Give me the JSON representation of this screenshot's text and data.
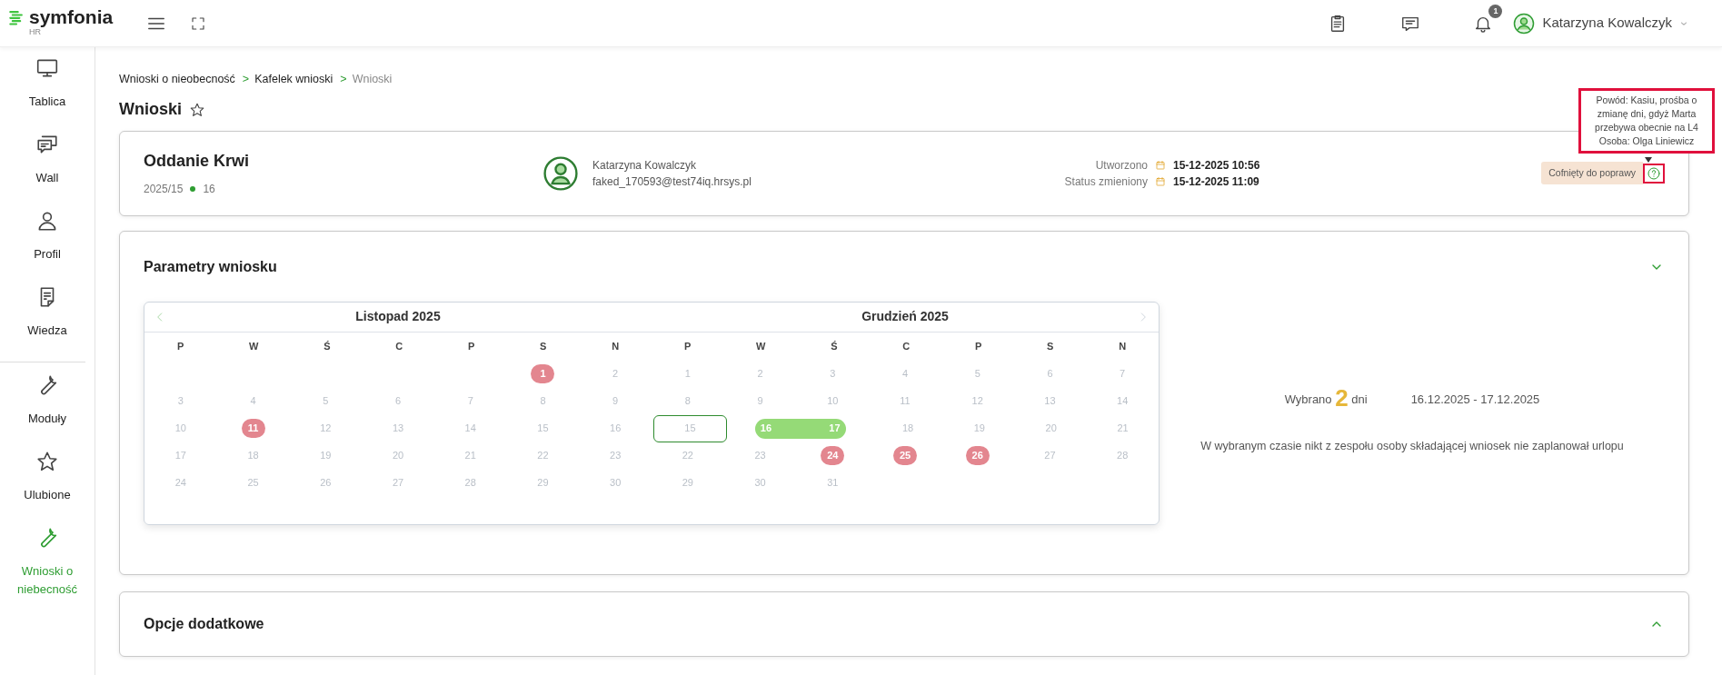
{
  "header": {
    "logo": {
      "name": "symfonia",
      "sub": "HR"
    },
    "notifications": {
      "count": "1"
    },
    "user": {
      "name": "Katarzyna Kowalczyk"
    }
  },
  "sidebar": {
    "groups": [
      {
        "items": [
          {
            "label": "Tablica",
            "selected": false
          },
          {
            "label": "Wall",
            "selected": false
          },
          {
            "label": "Profil",
            "selected": false
          },
          {
            "label": "Wiedza",
            "selected": false
          }
        ]
      },
      {
        "items": [
          {
            "label": "Moduły",
            "selected": false
          },
          {
            "label": "Ulubione",
            "selected": false
          },
          {
            "label": "Wnioski o niebecność",
            "selected": true
          }
        ]
      }
    ]
  },
  "breadcrumb": [
    {
      "label": "Wnioski o nieobecność",
      "current": false
    },
    {
      "separator": ">",
      "label": "Kafelek wnioski",
      "current": false
    },
    {
      "separator": ">",
      "label": "Wnioski",
      "current": true
    }
  ],
  "page": {
    "title": "Wnioski",
    "favorite": false
  },
  "request": {
    "title": "Oddanie Krwi",
    "number": "2025/15",
    "count": "16",
    "person": {
      "name": "Katarzyna Kowalczyk",
      "email": "faked_170593@test74iq.hrsys.pl"
    },
    "dates": [
      {
        "label": "Utworzono",
        "value": "15-12-2025 10:56"
      },
      {
        "label": "Status zmieniony",
        "value": "15-12-2025 11:09"
      }
    ],
    "status": {
      "label": "Cofnięty do poprawy",
      "tooltip": [
        "Powód: Kasiu, prośba o",
        "zmianę dni, gdyż Marta",
        "przebywa obecnie na L4",
        "Osoba: Olga Liniewicz"
      ]
    }
  },
  "sections": [
    {
      "title": "Parametry wniosku",
      "expanded": true
    },
    {
      "title": "Opcje dodatkowe",
      "expanded": false
    }
  ],
  "calendar": {
    "months": [
      {
        "title": "Listopad 2025",
        "weekdays": [
          "P",
          "W",
          "Ś",
          "C",
          "P",
          "S",
          "N"
        ],
        "weeks": [
          {
            "days": [
              {
                "kind": "blank"
              },
              {
                "kind": "blank"
              },
              {
                "kind": "blank"
              },
              {
                "kind": "blank"
              },
              {
                "kind": "blank"
              },
              {
                "day": "1",
                "kind": "holiday"
              },
              {
                "day": "2",
                "kind": "normal"
              }
            ]
          },
          {
            "days": [
              {
                "day": "3",
                "kind": "normal"
              },
              {
                "day": "4",
                "kind": "normal"
              },
              {
                "day": "5",
                "kind": "normal"
              },
              {
                "day": "6",
                "kind": "normal"
              },
              {
                "day": "7",
                "kind": "normal"
              },
              {
                "day": "8",
                "kind": "normal"
              },
              {
                "day": "9",
                "kind": "normal"
              }
            ]
          },
          {
            "days": [
              {
                "day": "10",
                "kind": "normal"
              },
              {
                "day": "11",
                "kind": "holiday"
              },
              {
                "day": "12",
                "kind": "normal"
              },
              {
                "day": "13",
                "kind": "normal"
              },
              {
                "day": "14",
                "kind": "normal"
              },
              {
                "day": "15",
                "kind": "normal"
              },
              {
                "day": "16",
                "kind": "normal"
              }
            ]
          },
          {
            "days": [
              {
                "day": "17",
                "kind": "normal"
              },
              {
                "day": "18",
                "kind": "normal"
              },
              {
                "day": "19",
                "kind": "normal"
              },
              {
                "day": "20",
                "kind": "normal"
              },
              {
                "day": "21",
                "kind": "normal"
              },
              {
                "day": "22",
                "kind": "normal"
              },
              {
                "day": "23",
                "kind": "normal"
              }
            ]
          },
          {
            "days": [
              {
                "day": "24",
                "kind": "normal"
              },
              {
                "day": "25",
                "kind": "normal"
              },
              {
                "day": "26",
                "kind": "normal"
              },
              {
                "day": "27",
                "kind": "normal"
              },
              {
                "day": "28",
                "kind": "normal"
              },
              {
                "day": "29",
                "kind": "normal"
              },
              {
                "day": "30",
                "kind": "normal"
              }
            ]
          }
        ]
      },
      {
        "title": "Grudzień 2025",
        "weekdays": [
          "P",
          "W",
          "Ś",
          "C",
          "P",
          "S",
          "N"
        ],
        "weeks": [
          {
            "days": [
              {
                "day": "1",
                "kind": "normal"
              },
              {
                "day": "2",
                "kind": "normal"
              },
              {
                "day": "3",
                "kind": "normal"
              },
              {
                "day": "4",
                "kind": "normal"
              },
              {
                "day": "5",
                "kind": "normal"
              },
              {
                "day": "6",
                "kind": "normal"
              },
              {
                "day": "7",
                "kind": "normal"
              }
            ]
          },
          {
            "days": [
              {
                "day": "8",
                "kind": "normal"
              },
              {
                "day": "9",
                "kind": "normal"
              },
              {
                "day": "10",
                "kind": "normal"
              },
              {
                "day": "11",
                "kind": "normal"
              },
              {
                "day": "12",
                "kind": "normal"
              },
              {
                "day": "13",
                "kind": "normal"
              },
              {
                "day": "14",
                "kind": "normal"
              }
            ]
          },
          {
            "days": [
              {
                "day": "15",
                "kind": "today"
              },
              {
                "day": "16",
                "kind": "selected"
              },
              {
                "day": "17",
                "kind": "selected"
              },
              {
                "day": "18",
                "kind": "normal"
              },
              {
                "day": "19",
                "kind": "normal"
              },
              {
                "day": "20",
                "kind": "normal"
              },
              {
                "day": "21",
                "kind": "normal"
              }
            ]
          },
          {
            "days": [
              {
                "day": "22",
                "kind": "normal"
              },
              {
                "day": "23",
                "kind": "normal"
              },
              {
                "day": "24",
                "kind": "holiday"
              },
              {
                "day": "25",
                "kind": "holiday"
              },
              {
                "day": "26",
                "kind": "holiday"
              },
              {
                "day": "27",
                "kind": "normal"
              },
              {
                "day": "28",
                "kind": "normal"
              }
            ]
          },
          {
            "days": [
              {
                "day": "29",
                "kind": "normal"
              },
              {
                "day": "30",
                "kind": "normal"
              },
              {
                "day": "31",
                "kind": "normal"
              },
              {
                "kind": "blank"
              },
              {
                "kind": "blank"
              },
              {
                "kind": "blank"
              },
              {
                "kind": "blank"
              }
            ]
          }
        ]
      }
    ]
  },
  "summary": {
    "prefix": "Wybrano",
    "count": "2",
    "suffix": "dni",
    "range": "16.12.2025 - 17.12.2025",
    "note": "W wybranym czasie nikt z zespołu osoby składającej wniosek nie zaplanował urlopu"
  }
}
